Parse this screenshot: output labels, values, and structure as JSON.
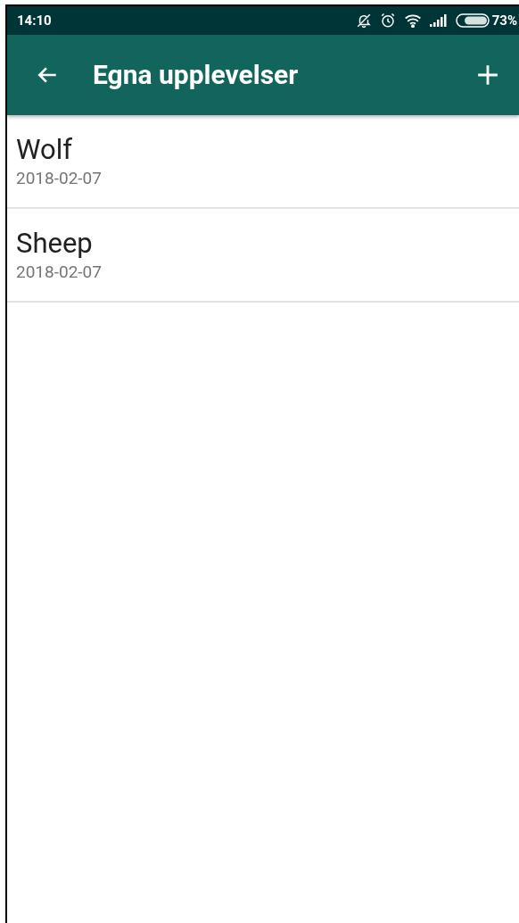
{
  "status_bar": {
    "time": "14:10",
    "battery": "73%"
  },
  "app_bar": {
    "title": "Egna upplevelser"
  },
  "items": [
    {
      "title": "Wolf",
      "date": "2018-02-07"
    },
    {
      "title": "Sheep",
      "date": "2018-02-07"
    }
  ]
}
